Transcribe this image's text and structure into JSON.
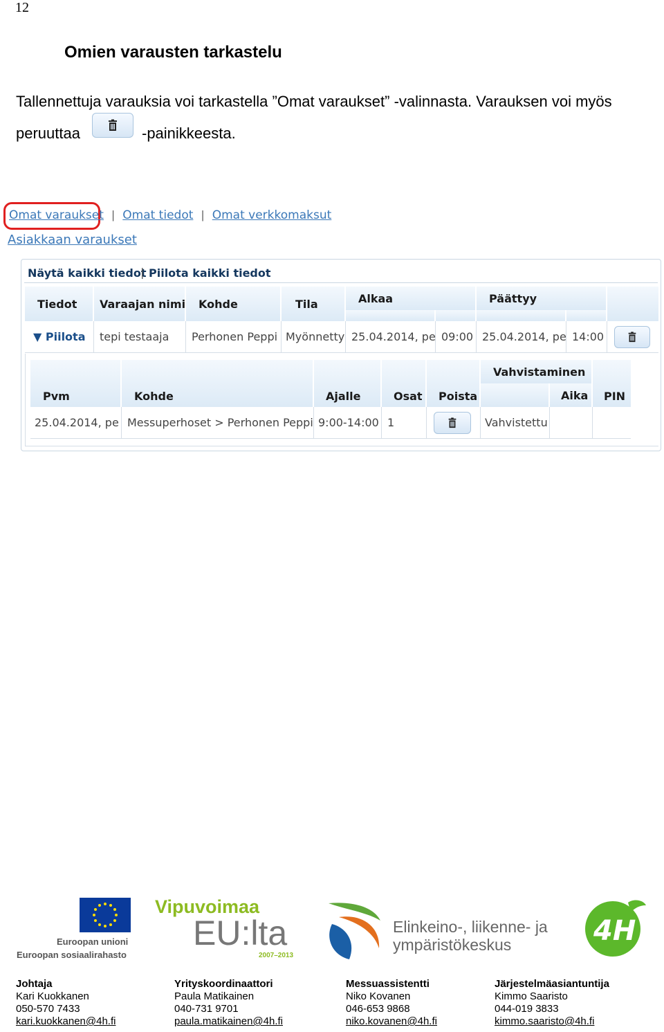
{
  "page_number": "12",
  "heading": "Omien varausten tarkastelu",
  "intro": {
    "line1": "Tallennettuja varauksia voi tarkastella ”Omat varaukset” -valinnasta. Varauksen voi myös",
    "line2_before": "peruuttaa",
    "line2_after": "-painikkeesta."
  },
  "nav": {
    "links": [
      "Omat varaukset",
      "Omat tiedot",
      "Omat verkkomaksut"
    ],
    "separator": "|",
    "customer_link": "Asiakkaan varaukset"
  },
  "toolbar": {
    "show_all": "Näytä kaikki tiedot",
    "separator": "|",
    "hide_all": "Piilota kaikki tiedot"
  },
  "booking_table": {
    "headers": {
      "tiedot": "Tiedot",
      "varaajan_nimi": "Varaajan nimi",
      "kohde": "Kohde",
      "tila": "Tila",
      "alkaa": "Alkaa",
      "paattyy": "Päättyy"
    },
    "row": {
      "toggle": "▼ Piilota",
      "varaaja": "tepi testaaja",
      "kohde": "Perhonen Peppi",
      "tila": "Myönnetty",
      "alkaa_pvm": "25.04.2014, pe",
      "alkaa_aika": "09:00",
      "paattyy_pvm": "25.04.2014, pe",
      "paattyy_aika": "14:00"
    }
  },
  "detail_table": {
    "headers": {
      "pvm": "Pvm",
      "kohde": "Kohde",
      "ajalle": "Ajalle",
      "osat": "Osat",
      "poista": "Poista",
      "vahvistaminen": "Vahvistaminen",
      "aika": "Aika",
      "pin": "PIN"
    },
    "row": {
      "pvm": "25.04.2014, pe",
      "kohde": "Messuperhoset > Perhonen Peppi",
      "ajalle": "9:00-14:00",
      "osat": "1",
      "vahvistus": "Vahvistettu",
      "aika": "",
      "pin": ""
    }
  },
  "logos": {
    "eu_line1": "Euroopan unioni",
    "eu_line2": "Euroopan sosiaalirahasto",
    "vipu": "Vipuvoimaa",
    "eulta": "EU:lta",
    "vipu_years": "2007–2013",
    "ely_line1": "Elinkeino-, liikenne- ja",
    "ely_line2": "ympäristökeskus",
    "fourh": "4H"
  },
  "contacts": [
    {
      "role": "Johtaja",
      "name": "Kari Kuokkanen",
      "phone": "050-570 7433",
      "email": "kari.kuokkanen@4h.fi"
    },
    {
      "role": "Yrityskoordinaattori",
      "name": "Paula Matikainen",
      "phone": "040-731 9701",
      "email": "paula.matikainen@4h.fi"
    },
    {
      "role": "Messuassistentti",
      "name": "Niko Kovanen",
      "phone": "046-653 9868",
      "email": "niko.kovanen@4h.fi"
    },
    {
      "role": "Järjestelmäasiantuntija",
      "name": "Kimmo Saaristo",
      "phone": "044-019 3833",
      "email": "kimmo.saaristo@4h.fi"
    }
  ],
  "colors": {
    "link": "#3b78b8",
    "highlight_ring": "#e02020",
    "header_text": "#14375e",
    "eu_blue": "#0a3a9a",
    "vipu_green": "#8dbb22",
    "fourh_green": "#5cb82b"
  }
}
